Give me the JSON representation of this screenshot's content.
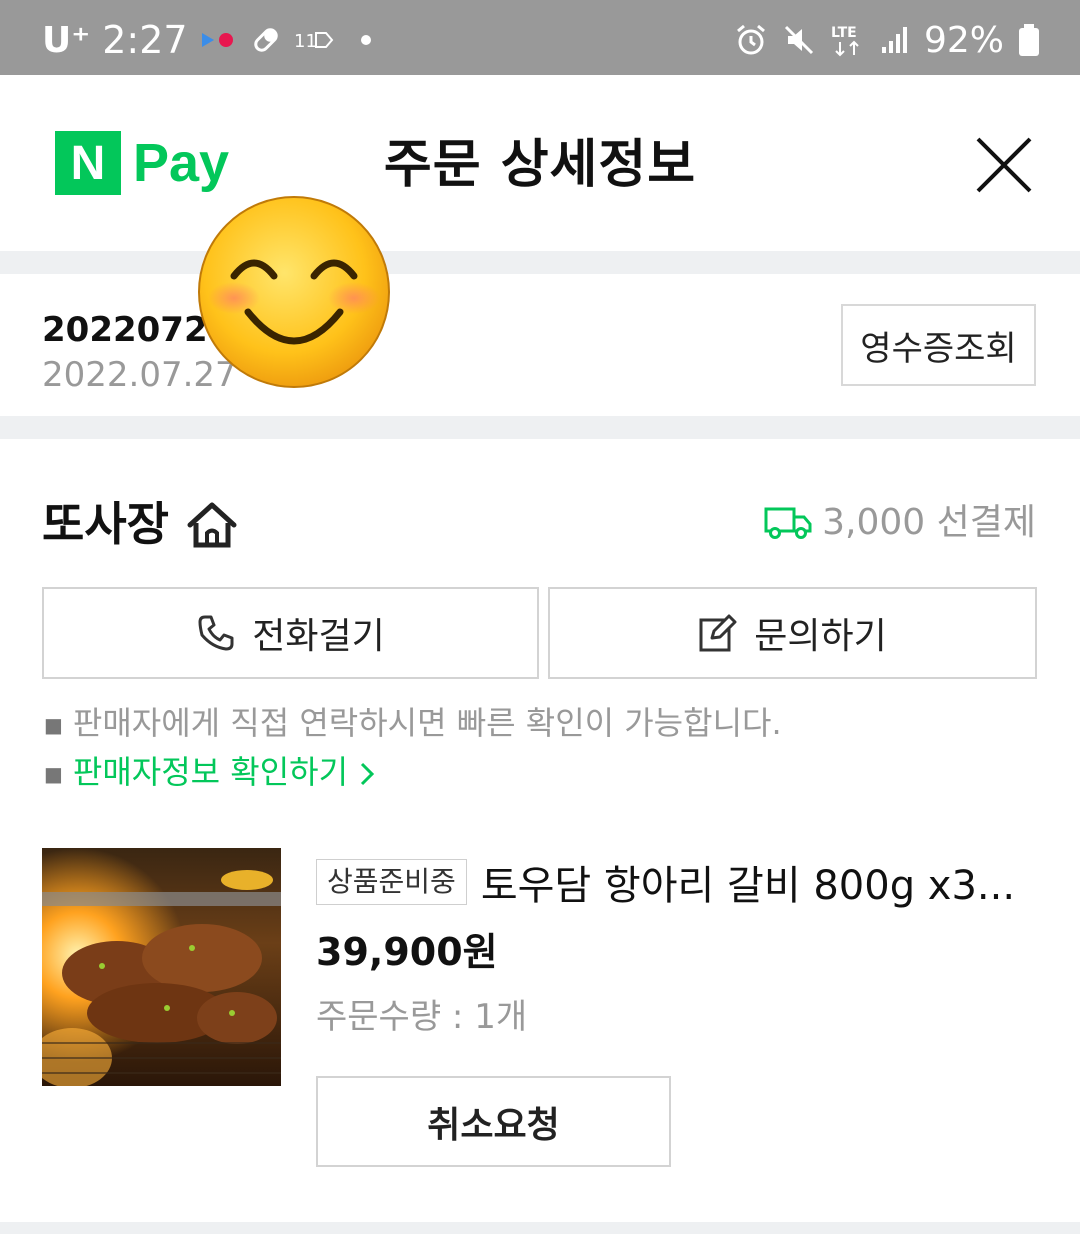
{
  "status_bar": {
    "carrier": "U⁺",
    "time": "2:27",
    "battery": "92%",
    "network": "LTE",
    "icons": [
      "dual-dot-icon",
      "pill-icon",
      "eleven-street-icon",
      "dot-icon",
      "alarm-icon",
      "mute-icon",
      "lte-icon",
      "signal-icon",
      "battery-icon"
    ]
  },
  "header": {
    "logo_n": "N",
    "logo_pay": "Pay",
    "title": "주문 상세정보",
    "close_icon": "close-icon"
  },
  "order": {
    "number_partial": "20220727",
    "date": "2022.07.27",
    "receipt_button": "영수증조회",
    "redaction": "smiling-emoji-sticker"
  },
  "seller": {
    "name": "또사장",
    "home_icon": "home-icon",
    "shipping": "3,000 선결제",
    "shipping_icon": "truck-icon",
    "call_button": "전화걸기",
    "inquiry_button": "문의하기",
    "notice": "판매자에게 직접 연락하시면 빠른 확인이 가능합니다.",
    "seller_info_link": "판매자정보 확인하기"
  },
  "product": {
    "status_badge": "상품준비중",
    "name": "토우담 항아리 갈비 800g x3...",
    "price": "39,900원",
    "quantity": "주문수량 : 1개",
    "cancel_button": "취소요청"
  },
  "colors": {
    "brand_green": "#03c75a",
    "status_bar_bg": "#999999",
    "separator": "#eef0f2",
    "muted_text": "#999999"
  }
}
